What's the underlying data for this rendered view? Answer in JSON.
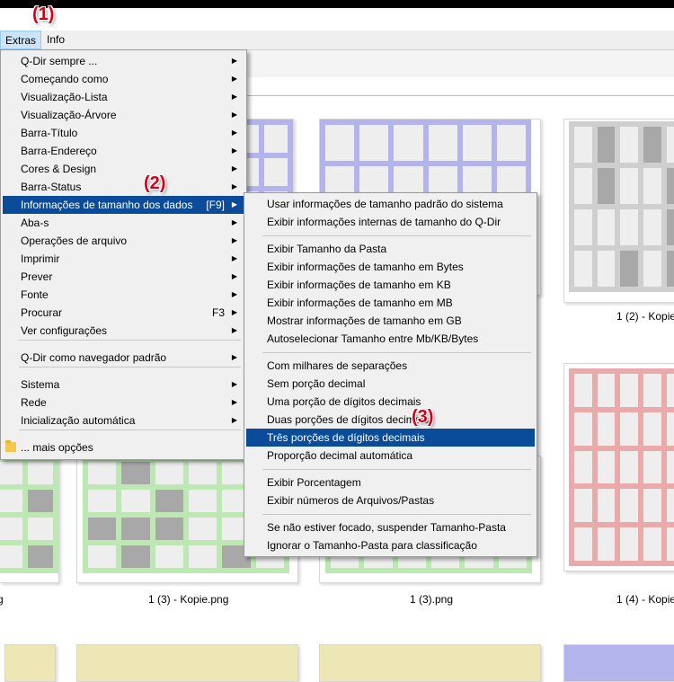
{
  "menubar": {
    "items": [
      "Extras",
      "Info"
    ]
  },
  "annotations": [
    "(1)",
    "(2)",
    "(3)"
  ],
  "main_menu": {
    "items": [
      {
        "label": "Q-Dir sempre ...",
        "shortcut": "",
        "submenu": true
      },
      {
        "label": "Começando como",
        "shortcut": "",
        "submenu": true
      },
      {
        "label": "Visualização-Lista",
        "shortcut": "",
        "submenu": true
      },
      {
        "label": "Visualização-Árvore",
        "shortcut": "",
        "submenu": true
      },
      {
        "label": "Barra-Título",
        "shortcut": "",
        "submenu": true
      },
      {
        "label": "Barra-Endereço",
        "shortcut": "",
        "submenu": true
      },
      {
        "label": "Cores & Design",
        "shortcut": "",
        "submenu": true
      },
      {
        "label": "Barra-Status",
        "shortcut": "",
        "submenu": true
      },
      {
        "label": "Informações de tamanho dos dados",
        "shortcut": "[F9]",
        "submenu": true,
        "selected": true
      },
      {
        "label": "Aba-s",
        "shortcut": "",
        "submenu": true
      },
      {
        "label": "Operações de arquivo",
        "shortcut": "",
        "submenu": true
      },
      {
        "label": "Imprimir",
        "shortcut": "",
        "submenu": true
      },
      {
        "label": "Prever",
        "shortcut": "",
        "submenu": true
      },
      {
        "label": "Fonte",
        "shortcut": "",
        "submenu": true
      },
      {
        "label": "Procurar",
        "shortcut": "F3",
        "submenu": true
      },
      {
        "label": "Ver configurações",
        "shortcut": "",
        "submenu": true
      },
      {
        "label": "Q-Dir como navegador padrão",
        "shortcut": "",
        "submenu": true
      },
      {
        "label": "Sistema",
        "shortcut": "",
        "submenu": true
      },
      {
        "label": "Rede",
        "shortcut": "",
        "submenu": true
      },
      {
        "label": "Inicialização automática",
        "shortcut": "",
        "submenu": true
      },
      {
        "label": "... mais opções",
        "shortcut": "",
        "submenu": false
      }
    ]
  },
  "sub_menu": {
    "items": [
      "Usar informações de tamanho padrão do sistema",
      "Exibir informações internas de tamanho do Q-Dir",
      "Exibir Tamanho da Pasta",
      "Exibir informações de tamanho em Bytes",
      "Exibir informações de tamanho em KB",
      "Exibir informações de tamanho em MB",
      "Mostrar informações de tamanho em GB",
      "Autoselecionar Tamanho entre Mb/KB/Bytes",
      "Com milhares de separações",
      "Sem porção decimal",
      "Uma porção de dígitos decimais",
      "Duas porções de dígitos decimais",
      "Três porções de dígitos decimais",
      "Proporção decimal automática",
      "Exibir Porcentagem",
      "Exibir números de Arquivos/Pastas",
      "Se não estiver focado, suspender Tamanho-Pasta",
      "Ignorar o Tamanho-Pasta para classificação"
    ],
    "selected_index": 12
  },
  "files": {
    "captions": [
      "1 (2) - Kopie",
      "1 (3) - Kopie.png",
      "1 (3).png",
      "1 (4) - Kopie",
      "g"
    ]
  },
  "colors": {
    "menu_selected": "#0a4c99",
    "annotation": "#d4001a",
    "thumb_blue": "#b4b4ec",
    "thumb_green": "#bde8b4",
    "thumb_red": "#eaaaaa",
    "thumb_gray": "#cfcfcf",
    "thumb_yellow": "#ece7b4"
  }
}
